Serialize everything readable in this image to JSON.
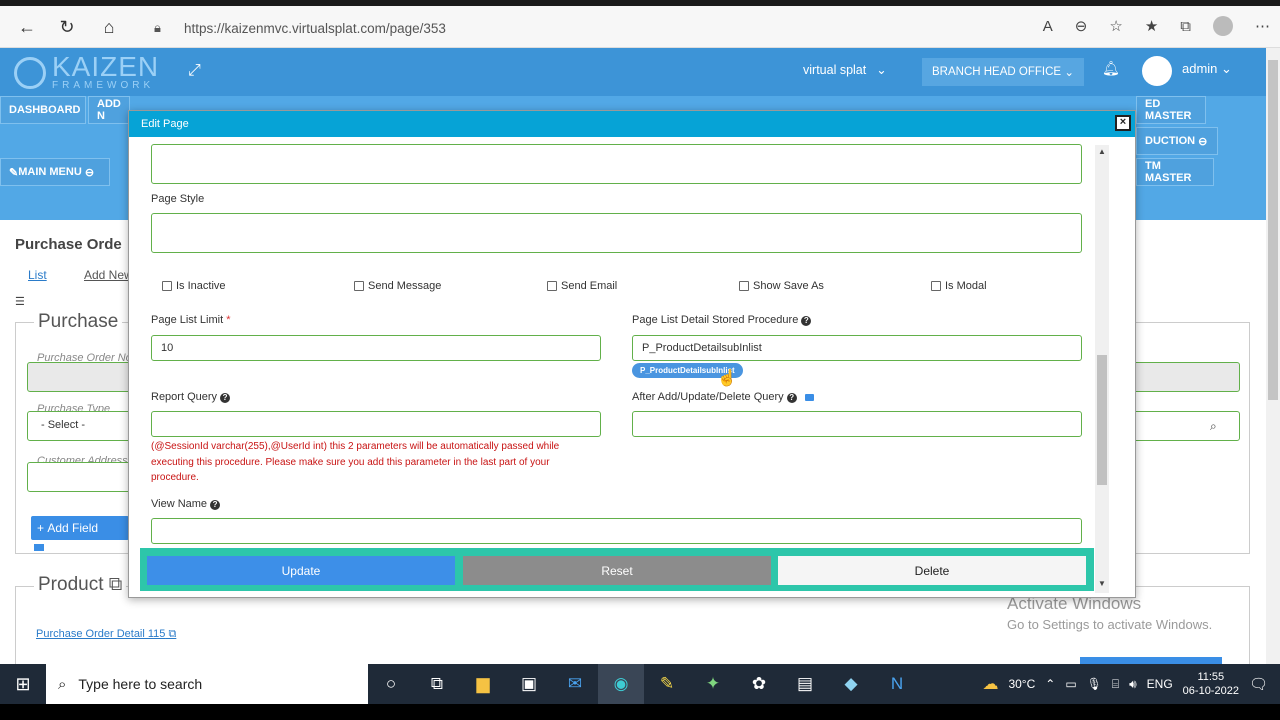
{
  "browser": {
    "url": "https://kaizenmvc.virtualsplat.com/page/353"
  },
  "header": {
    "logo_text": "KAIZEN",
    "logo_sub": "FRAMEWORK",
    "company": "virtual splat",
    "branch": "BRANCH HEAD OFFICE",
    "user": "admin"
  },
  "menu": {
    "dashboard": "DASHBOARD",
    "add_new": "ADD N",
    "main_menu": "MAIN MENU",
    "ed_master": "ED MASTER",
    "duction": "DUCTION",
    "tm_master": "TM MASTER"
  },
  "page": {
    "title": "Purchase Orde",
    "tab_list": "List",
    "tab_add": "Add New",
    "legend_purchase": "Purchase",
    "label_po_no": "Purchase Order No",
    "label_type": "Purchase Type",
    "select_default": "- Select -",
    "label_customer": "Customer Address",
    "add_field": "Add Field",
    "legend_product": "Product",
    "po_detail_link": "Purchase Order Detail 115"
  },
  "modal": {
    "title": "Edit Page",
    "page_style_label": "Page Style",
    "checkboxes": {
      "inactive": "Is Inactive",
      "send_message": "Send Message",
      "send_email": "Send Email",
      "show_save_as": "Show Save As",
      "is_modal": "Is Modal"
    },
    "page_list_limit_label": "Page List Limit",
    "page_list_limit_value": "10",
    "stored_proc_label": "Page List Detail Stored Procedure",
    "stored_proc_value": "P_ProductDetailsubInlist",
    "stored_proc_chip": "P_ProductDetailsubInlist",
    "report_query_label": "Report Query",
    "after_query_label": "After Add/Update/Delete Query",
    "note": "(@SessionId varchar(255),@UserId int) this 2 parameters will be automatically passed while executing this procedure. Please make sure you add this parameter in the last part of your procedure.",
    "view_name_label": "View Name",
    "btn_update": "Update",
    "btn_reset": "Reset",
    "btn_delete": "Delete"
  },
  "watermark": {
    "line1": "Activate Windows",
    "line2": "Go to Settings to activate Windows."
  },
  "taskbar": {
    "search_placeholder": "Type here to search",
    "temperature": "30°C",
    "language": "ENG",
    "time": "11:55",
    "date": "06-10-2022"
  },
  "colors": {
    "accent": "#3d94d7",
    "modal_header": "#06a3d6",
    "input_border": "#62b04a",
    "update_btn": "#3d8fe8",
    "reset_btn": "#8c8c8c",
    "button_bar": "#2dc6aa",
    "note_text": "#c81414"
  }
}
